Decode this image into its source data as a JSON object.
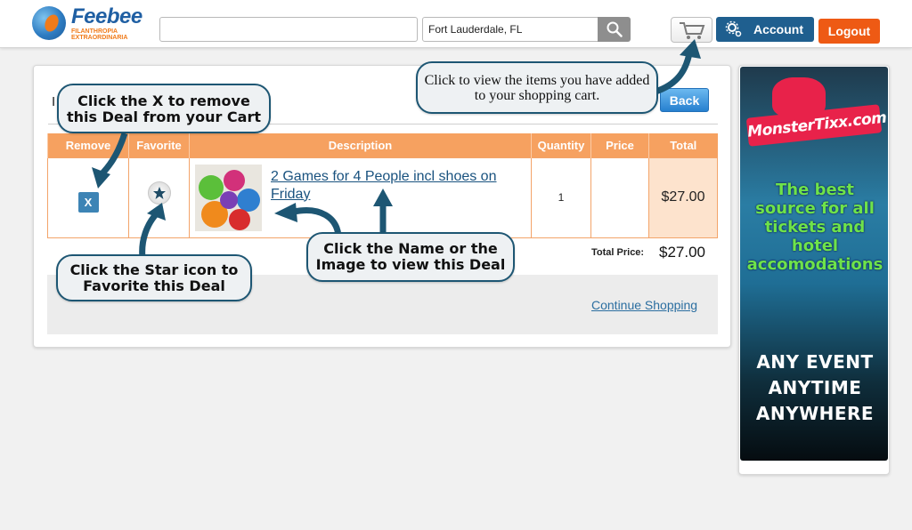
{
  "header": {
    "logo_name": "Feebee",
    "logo_tagline": "FILANTHROPIA EXTRAORDINARIA",
    "search_value": "",
    "location_value": "Fort Lauderdale, FL",
    "account_label": "Account",
    "logout_label": "Logout",
    "colors": {
      "account": "#1f5f8f",
      "logout": "#ee5a14"
    }
  },
  "cart": {
    "heading_letter": "I",
    "back_label": "Back",
    "columns": [
      "Remove",
      "Favorite",
      "Description",
      "Quantity",
      "Price",
      "Total"
    ],
    "items": [
      {
        "remove_label": "X",
        "title": "2 Games for 4 People incl shoes on Friday",
        "quantity": "1",
        "price": "",
        "total": "$27.00"
      }
    ],
    "total_label": "Total Price:",
    "total_value": "$27.00",
    "continue_label": "Continue Shopping"
  },
  "callouts": {
    "cart_tip": "Click to view the items you have added to your shopping cart.",
    "remove_tip": "Click the X to remove this Deal from your Cart",
    "favorite_tip": "Click the Star icon to Favorite this Deal",
    "name_tip": "Click the Name or the Image to view this Deal"
  },
  "ad": {
    "logo_text": "MonsterTixx.com",
    "tagline": "The best source for all tickets and hotel accomodations",
    "bottom_text": "ANY EVENT ANYTIME ANYWHERE"
  }
}
